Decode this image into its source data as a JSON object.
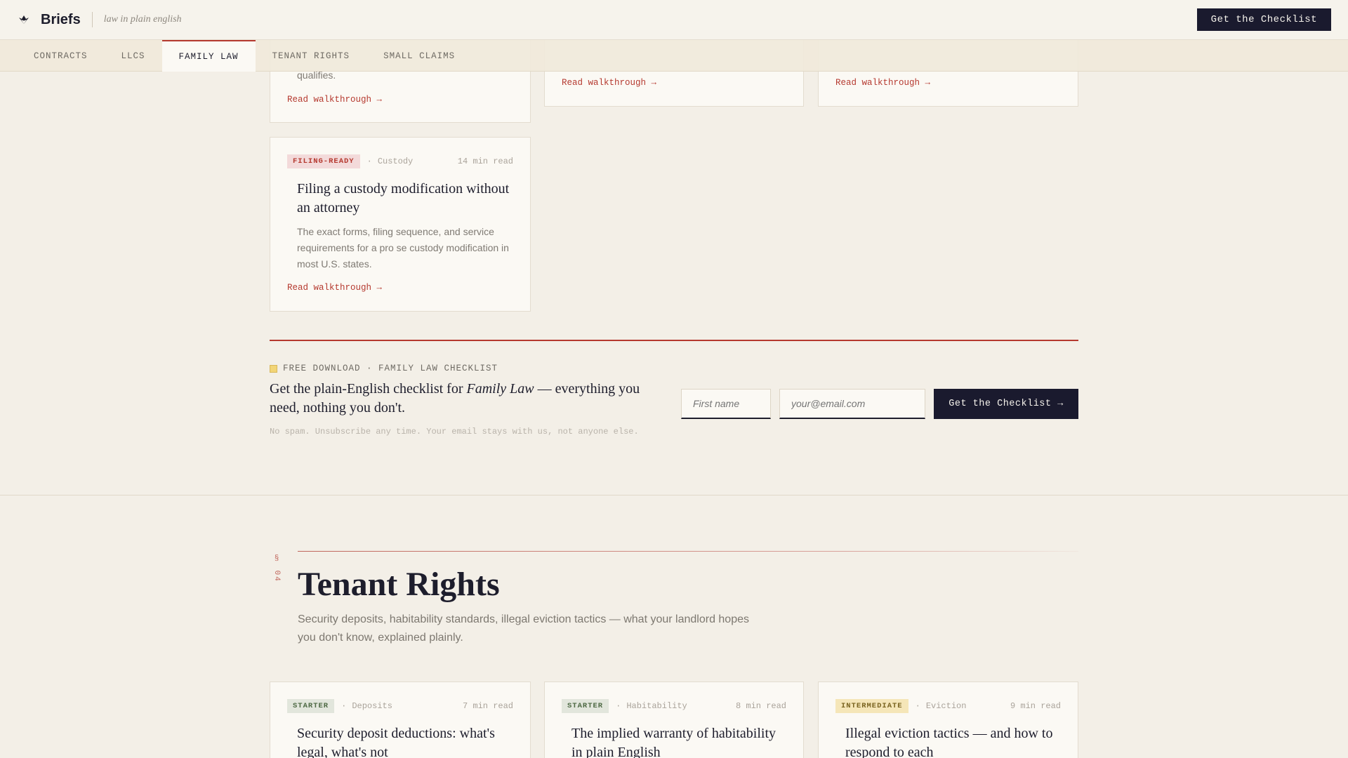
{
  "header": {
    "brand": "Briefs",
    "tagline": "law in plain english",
    "cta_label": "Get the Checklist"
  },
  "tabs": [
    {
      "label": "CONTRACTS",
      "active": false
    },
    {
      "label": "LLCS",
      "active": false
    },
    {
      "label": "FAMILY LAW",
      "active": true
    },
    {
      "label": "TENANT RIGHTS",
      "active": false
    },
    {
      "label": "SMALL CLAIMS",
      "active": false
    }
  ],
  "family_law": {
    "partial_cards": [
      {
        "desc_tail": "qualifies.",
        "link": "Read walkthrough →"
      },
      {
        "link": "Read walkthrough →"
      },
      {
        "link": "Read walkthrough →"
      }
    ],
    "card": {
      "badge": "FILING-READY",
      "category": "Custody",
      "read_time": "14 min read",
      "title": "Filing a custody modification without an attorney",
      "desc": "The exact forms, filing sequence, and service requirements for a pro se custody modification in most U.S. states.",
      "link": "Read walkthrough →"
    }
  },
  "newsletter": {
    "kicker": "FREE DOWNLOAD · FAMILY LAW CHECKLIST",
    "headline_pre": "Get the plain-English checklist for ",
    "headline_em": "Family Law",
    "headline_post": " — everything you need, nothing you don't.",
    "fine_print": "No spam. Unsubscribe any time. Your email stays with us, not anyone else.",
    "first_name_placeholder": "First name",
    "email_placeholder": "your@email.com",
    "button_label": "Get the Checklist →"
  },
  "tenant_rights": {
    "section_number": "§ 04",
    "title": "Tenant Rights",
    "desc": "Security deposits, habitability standards, illegal eviction tactics — what your landlord hopes you don't know, explained plainly.",
    "cards": [
      {
        "badge": "STARTER",
        "category": "Deposits",
        "read_time": "7 min read",
        "title": "Security deposit deductions: what's legal, what's not"
      },
      {
        "badge": "STARTER",
        "category": "Habitability",
        "read_time": "8 min read",
        "title": "The implied warranty of habitability in plain English"
      },
      {
        "badge": "INTERMEDIATE",
        "category": "Eviction",
        "read_time": "9 min read",
        "title": "Illegal eviction tactics — and how to respond to each"
      }
    ]
  },
  "colors": {
    "accent_red": "#b5392f",
    "navy": "#1a1a2e",
    "background": "#f3efe7"
  }
}
